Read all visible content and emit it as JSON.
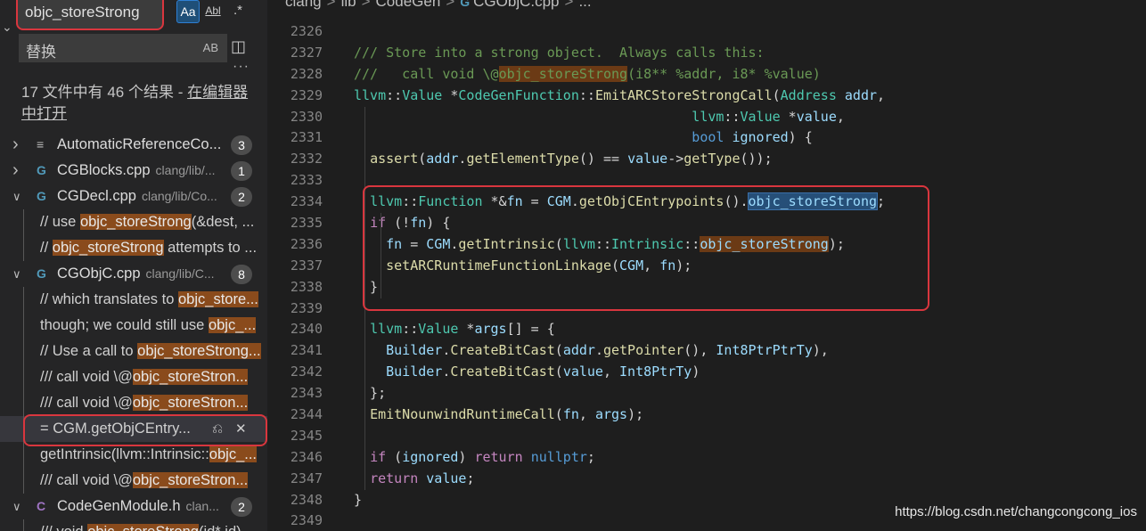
{
  "search": {
    "query": "objc_storeStrong",
    "match_case_label": "Aa",
    "whole_word_label": "Abl",
    "regex_label": ".*"
  },
  "replace": {
    "value": "替换",
    "preserve_case_label": "AB"
  },
  "summary": {
    "text": "17 文件中有 46 个结果 - ",
    "open_in_editor": "在编辑器中打开"
  },
  "results": [
    {
      "kind": "file",
      "twisty": ">",
      "icon": "≡",
      "icon_color": "#bbbbbb",
      "name": "AutomaticReferenceCo...",
      "path": "",
      "count": "3"
    },
    {
      "kind": "file",
      "twisty": ">",
      "icon": "G",
      "icon_color": "#519aba",
      "name": "CGBlocks.cpp",
      "path": "clang/lib/...",
      "count": "1"
    },
    {
      "kind": "file",
      "twisty": "v",
      "icon": "G",
      "icon_color": "#519aba",
      "name": "CGDecl.cpp",
      "path": "clang/lib/Co...",
      "count": "2"
    },
    {
      "kind": "match",
      "pre": "// use ",
      "hit": "objc_storeStrong",
      "post": "(&dest, ..."
    },
    {
      "kind": "match",
      "pre": "// ",
      "hit": "objc_storeStrong",
      "post": " attempts to ..."
    },
    {
      "kind": "file",
      "twisty": "v",
      "icon": "G",
      "icon_color": "#519aba",
      "name": "CGObjC.cpp",
      "path": "clang/lib/C...",
      "count": "8"
    },
    {
      "kind": "match",
      "pre": "// which translates to ",
      "hit": "objc_store...",
      "post": ""
    },
    {
      "kind": "match",
      "pre": "though;  we could still use ",
      "hit": "objc_...",
      "post": ""
    },
    {
      "kind": "match",
      "pre": "// Use a call to ",
      "hit": "objc_storeStrong...",
      "post": ""
    },
    {
      "kind": "match",
      "pre": "///   call void \\@",
      "hit": "objc_storeStron...",
      "post": ""
    },
    {
      "kind": "match",
      "pre": "///   call void \\@",
      "hit": "objc_storeStron...",
      "post": ""
    },
    {
      "kind": "match",
      "selected": true,
      "pre": "= CGM.getObjCEntry...",
      "hit": "",
      "post": ""
    },
    {
      "kind": "match",
      "pre": "getIntrinsic(llvm::Intrinsic::",
      "hit": "objc_...",
      "post": ""
    },
    {
      "kind": "match",
      "pre": "///   call void \\@",
      "hit": "objc_storeStron...",
      "post": ""
    },
    {
      "kind": "file",
      "twisty": "v",
      "icon": "C",
      "icon_color": "#a074c4",
      "name": "CodeGenModule.h",
      "path": "clan...",
      "count": "2"
    },
    {
      "kind": "match",
      "pre": "/// void ",
      "hit": "objc_storeStrong",
      "post": "(id* id)"
    }
  ],
  "breadcrumb": {
    "parts": [
      "clang",
      "lib",
      "CodeGen"
    ],
    "file_icon": "G",
    "file": "CGObjC.cpp",
    "tail": "..."
  },
  "editor": {
    "line_numbers": [
      "2326",
      "2327",
      "2328",
      "2329",
      "2330",
      "2331",
      "2332",
      "2333",
      "2334",
      "2335",
      "2336",
      "2337",
      "2338",
      "2339",
      "2340",
      "2341",
      "2342",
      "2343",
      "2344",
      "2345",
      "2346",
      "2347",
      "2348",
      "2349"
    ],
    "lines": [
      [],
      [
        {
          "c": "cm",
          "t": "/// Store into a strong object.  Always calls this:"
        }
      ],
      [
        {
          "c": "cm",
          "t": "///   call void \\@"
        },
        {
          "c": "cm mhl",
          "t": "objc_storeStrong"
        },
        {
          "c": "cm",
          "t": "(i8** %addr, i8* %value)"
        }
      ],
      [
        {
          "c": "ty",
          "t": "llvm"
        },
        {
          "c": "pl",
          "t": "::"
        },
        {
          "c": "ty",
          "t": "Value"
        },
        {
          "c": "pl",
          "t": " *"
        },
        {
          "c": "ty",
          "t": "CodeGenFunction"
        },
        {
          "c": "pl",
          "t": "::"
        },
        {
          "c": "fn",
          "t": "EmitARCStoreStrongCall"
        },
        {
          "c": "pl",
          "t": "("
        },
        {
          "c": "ty",
          "t": "Address"
        },
        {
          "c": "pl",
          "t": " "
        },
        {
          "c": "va",
          "t": "addr"
        },
        {
          "c": "pl",
          "t": ","
        }
      ],
      [
        {
          "c": "pl",
          "t": "                                          "
        },
        {
          "c": "ty",
          "t": "llvm"
        },
        {
          "c": "pl",
          "t": "::"
        },
        {
          "c": "ty",
          "t": "Value"
        },
        {
          "c": "pl",
          "t": " *"
        },
        {
          "c": "va",
          "t": "value"
        },
        {
          "c": "pl",
          "t": ","
        }
      ],
      [
        {
          "c": "pl",
          "t": "                                          "
        },
        {
          "c": "k",
          "t": "bool"
        },
        {
          "c": "pl",
          "t": " "
        },
        {
          "c": "va",
          "t": "ignored"
        },
        {
          "c": "pl",
          "t": ") {"
        }
      ],
      [
        {
          "c": "pl",
          "t": "  "
        },
        {
          "c": "fn",
          "t": "assert"
        },
        {
          "c": "pl",
          "t": "("
        },
        {
          "c": "va",
          "t": "addr"
        },
        {
          "c": "pl",
          "t": "."
        },
        {
          "c": "fn",
          "t": "getElementType"
        },
        {
          "c": "pl",
          "t": "() == "
        },
        {
          "c": "va",
          "t": "value"
        },
        {
          "c": "pl",
          "t": "->"
        },
        {
          "c": "fn",
          "t": "getType"
        },
        {
          "c": "pl",
          "t": "());"
        }
      ],
      [],
      [
        {
          "c": "pl",
          "t": "  "
        },
        {
          "c": "ty",
          "t": "llvm"
        },
        {
          "c": "pl",
          "t": "::"
        },
        {
          "c": "ty",
          "t": "Function"
        },
        {
          "c": "pl",
          "t": " *&"
        },
        {
          "c": "va",
          "t": "fn"
        },
        {
          "c": "pl",
          "t": " = "
        },
        {
          "c": "va",
          "t": "CGM"
        },
        {
          "c": "pl",
          "t": "."
        },
        {
          "c": "fn",
          "t": "getObjCEntrypoints"
        },
        {
          "c": "pl",
          "t": "()."
        },
        {
          "c": "va mhl-cur",
          "t": "objc_storeStrong"
        },
        {
          "c": "pl",
          "t": ";"
        }
      ],
      [
        {
          "c": "pl",
          "t": "  "
        },
        {
          "c": "kc",
          "t": "if"
        },
        {
          "c": "pl",
          "t": " (!"
        },
        {
          "c": "va",
          "t": "fn"
        },
        {
          "c": "pl",
          "t": ") {"
        }
      ],
      [
        {
          "c": "pl",
          "t": "    "
        },
        {
          "c": "va",
          "t": "fn"
        },
        {
          "c": "pl",
          "t": " = "
        },
        {
          "c": "va",
          "t": "CGM"
        },
        {
          "c": "pl",
          "t": "."
        },
        {
          "c": "fn",
          "t": "getIntrinsic"
        },
        {
          "c": "pl",
          "t": "("
        },
        {
          "c": "ty",
          "t": "llvm"
        },
        {
          "c": "pl",
          "t": "::"
        },
        {
          "c": "ty",
          "t": "Intrinsic"
        },
        {
          "c": "pl",
          "t": "::"
        },
        {
          "c": "va mhl",
          "t": "objc_storeStrong"
        },
        {
          "c": "pl",
          "t": ");"
        }
      ],
      [
        {
          "c": "pl",
          "t": "    "
        },
        {
          "c": "fn",
          "t": "setARCRuntimeFunctionLinkage"
        },
        {
          "c": "pl",
          "t": "("
        },
        {
          "c": "va",
          "t": "CGM"
        },
        {
          "c": "pl",
          "t": ", "
        },
        {
          "c": "va",
          "t": "fn"
        },
        {
          "c": "pl",
          "t": ");"
        }
      ],
      [
        {
          "c": "pl",
          "t": "  }"
        }
      ],
      [],
      [
        {
          "c": "pl",
          "t": "  "
        },
        {
          "c": "ty",
          "t": "llvm"
        },
        {
          "c": "pl",
          "t": "::"
        },
        {
          "c": "ty",
          "t": "Value"
        },
        {
          "c": "pl",
          "t": " *"
        },
        {
          "c": "va",
          "t": "args"
        },
        {
          "c": "pl",
          "t": "[] = {"
        }
      ],
      [
        {
          "c": "pl",
          "t": "    "
        },
        {
          "c": "va",
          "t": "Builder"
        },
        {
          "c": "pl",
          "t": "."
        },
        {
          "c": "fn",
          "t": "CreateBitCast"
        },
        {
          "c": "pl",
          "t": "("
        },
        {
          "c": "va",
          "t": "addr"
        },
        {
          "c": "pl",
          "t": "."
        },
        {
          "c": "fn",
          "t": "getPointer"
        },
        {
          "c": "pl",
          "t": "(), "
        },
        {
          "c": "va",
          "t": "Int8PtrPtrTy"
        },
        {
          "c": "pl",
          "t": "),"
        }
      ],
      [
        {
          "c": "pl",
          "t": "    "
        },
        {
          "c": "va",
          "t": "Builder"
        },
        {
          "c": "pl",
          "t": "."
        },
        {
          "c": "fn",
          "t": "CreateBitCast"
        },
        {
          "c": "pl",
          "t": "("
        },
        {
          "c": "va",
          "t": "value"
        },
        {
          "c": "pl",
          "t": ", "
        },
        {
          "c": "va",
          "t": "Int8PtrTy"
        },
        {
          "c": "pl",
          "t": ")"
        }
      ],
      [
        {
          "c": "pl",
          "t": "  };"
        }
      ],
      [
        {
          "c": "pl",
          "t": "  "
        },
        {
          "c": "fn",
          "t": "EmitNounwindRuntimeCall"
        },
        {
          "c": "pl",
          "t": "("
        },
        {
          "c": "va",
          "t": "fn"
        },
        {
          "c": "pl",
          "t": ", "
        },
        {
          "c": "va",
          "t": "args"
        },
        {
          "c": "pl",
          "t": ");"
        }
      ],
      [],
      [
        {
          "c": "pl",
          "t": "  "
        },
        {
          "c": "kc",
          "t": "if"
        },
        {
          "c": "pl",
          "t": " ("
        },
        {
          "c": "va",
          "t": "ignored"
        },
        {
          "c": "pl",
          "t": ") "
        },
        {
          "c": "kc",
          "t": "return"
        },
        {
          "c": "pl",
          "t": " "
        },
        {
          "c": "k",
          "t": "nullptr"
        },
        {
          "c": "pl",
          "t": ";"
        }
      ],
      [
        {
          "c": "pl",
          "t": "  "
        },
        {
          "c": "kc",
          "t": "return"
        },
        {
          "c": "pl",
          "t": " "
        },
        {
          "c": "va",
          "t": "value"
        },
        {
          "c": "pl",
          "t": ";"
        }
      ],
      [
        {
          "c": "pl",
          "t": "}"
        }
      ],
      []
    ]
  },
  "watermark": "https://blog.csdn.net/changcongcong_ios"
}
